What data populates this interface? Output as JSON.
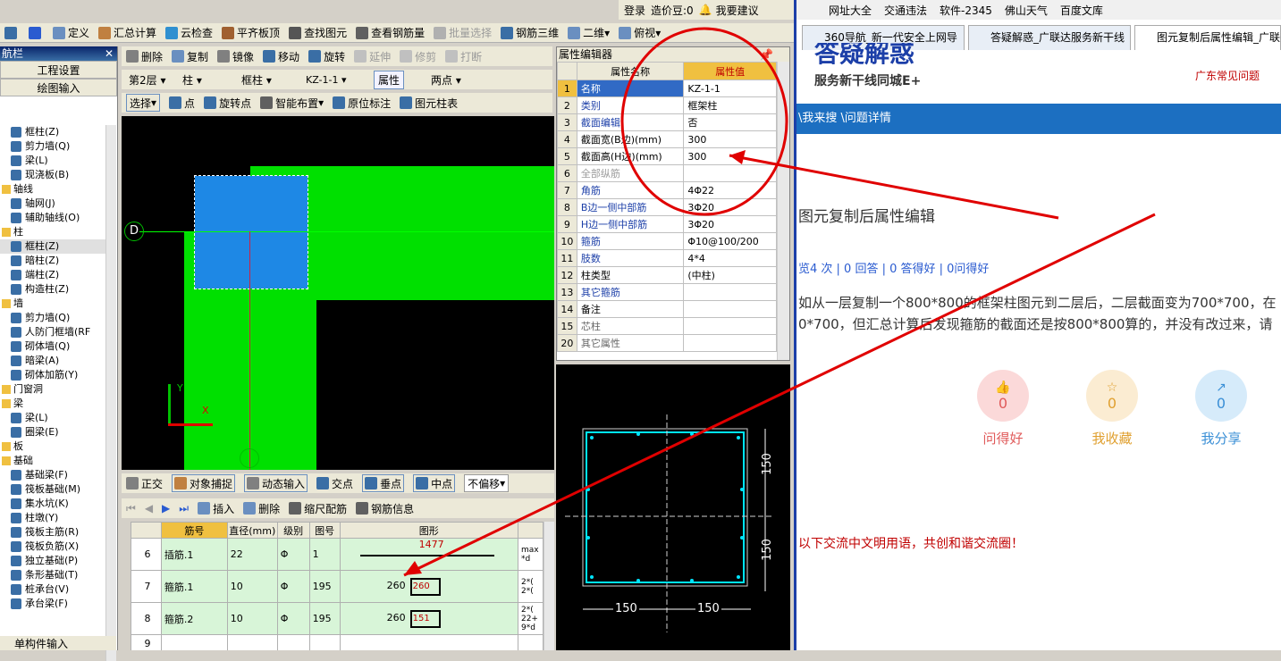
{
  "app": {
    "toolbar1": [
      "定义",
      "汇总计算",
      "云检查",
      "平齐板顶",
      "查找图元",
      "查看钢筋量",
      "批量选择",
      "钢筋三维",
      "二维",
      "俯视"
    ],
    "toolbar2": [
      "删除",
      "复制",
      "镜像",
      "移动",
      "旋转",
      "延伸",
      "修剪",
      "打断"
    ],
    "toolbar3": {
      "floor": "第2层",
      "type": "柱",
      "subtype": "框柱",
      "name": "KZ-1-1",
      "props": "属性",
      "twopoint": "两点"
    },
    "toolbar4": [
      "选择",
      "点",
      "旋转点",
      "智能布置",
      "原位标注",
      "图元柱表"
    ],
    "nav_title": "航栏",
    "nav_buttons": [
      "工程设置",
      "绘图输入"
    ],
    "nav_tree": [
      {
        "label": "框柱(Z)",
        "level": 2
      },
      {
        "label": "剪力墙(Q)",
        "level": 2
      },
      {
        "label": "梁(L)",
        "level": 2
      },
      {
        "label": "现浇板(B)",
        "level": 2
      },
      {
        "label": "轴线",
        "level": 1
      },
      {
        "label": "轴网(J)",
        "level": 2
      },
      {
        "label": "辅助轴线(O)",
        "level": 2
      },
      {
        "label": "柱",
        "level": 1
      },
      {
        "label": "框柱(Z)",
        "level": 2,
        "selected": true
      },
      {
        "label": "暗柱(Z)",
        "level": 2
      },
      {
        "label": "端柱(Z)",
        "level": 2
      },
      {
        "label": "构造柱(Z)",
        "level": 2
      },
      {
        "label": "墙",
        "level": 1
      },
      {
        "label": "剪力墙(Q)",
        "level": 2
      },
      {
        "label": "人防门框墙(RF",
        "level": 2
      },
      {
        "label": "砌体墙(Q)",
        "level": 2
      },
      {
        "label": "暗梁(A)",
        "level": 2
      },
      {
        "label": "砌体加筋(Y)",
        "level": 2
      },
      {
        "label": "门窗洞",
        "level": 1
      },
      {
        "label": "梁",
        "level": 1
      },
      {
        "label": "梁(L)",
        "level": 2
      },
      {
        "label": "圈梁(E)",
        "level": 2
      },
      {
        "label": "板",
        "level": 1
      },
      {
        "label": "基础",
        "level": 1
      },
      {
        "label": "基础梁(F)",
        "level": 2
      },
      {
        "label": "筏板基础(M)",
        "level": 2
      },
      {
        "label": "集水坑(K)",
        "level": 2
      },
      {
        "label": "柱墩(Y)",
        "level": 2
      },
      {
        "label": "筏板主筋(R)",
        "level": 2
      },
      {
        "label": "筏板负筋(X)",
        "level": 2
      },
      {
        "label": "独立基础(P)",
        "level": 2
      },
      {
        "label": "条形基础(T)",
        "level": 2
      },
      {
        "label": "桩承台(V)",
        "level": 2
      },
      {
        "label": "承台梁(F)",
        "level": 2
      }
    ],
    "nav_bottom": "单构件输入",
    "canvas": {
      "axis_label": "D",
      "y_label": "Y",
      "x_label": "X"
    },
    "snap_bar": [
      "正交",
      "对象捕捉",
      "动态输入",
      "交点",
      "垂点",
      "中点",
      "不偏移"
    ],
    "rebar_bar": [
      "插入",
      "删除",
      "缩尺配筋",
      "钢筋信息"
    ],
    "rebar_headers": [
      "筋号",
      "直径(mm)",
      "级别",
      "图号",
      "图形"
    ],
    "rebar_rows": [
      {
        "num": "6",
        "name": "插筋.1",
        "dia": "22",
        "grade": "Φ",
        "fig": "1",
        "shape_val": "1477",
        "val2": "",
        "extra": "max\n*d"
      },
      {
        "num": "7",
        "name": "箍筋.1",
        "dia": "10",
        "grade": "Φ",
        "fig": "195",
        "shape_val": "260",
        "val2": "260",
        "extra": "2*(\n2*("
      },
      {
        "num": "8",
        "name": "箍筋.2",
        "dia": "10",
        "grade": "Φ",
        "fig": "195",
        "shape_val": "260",
        "val2": "151",
        "extra": "2*(\n22+\n9*d"
      },
      {
        "num": "9",
        "name": "",
        "dia": "",
        "grade": "",
        "fig": "",
        "shape_val": "",
        "val2": "",
        "extra": ""
      }
    ],
    "prop_title": "属性编辑器",
    "prop_headers": [
      "属性名称",
      "属性值"
    ],
    "props": [
      {
        "n": "1",
        "name": "名称",
        "val": "KZ-1-1",
        "style": "sel"
      },
      {
        "n": "2",
        "name": "类别",
        "val": "框架柱",
        "style": "blue"
      },
      {
        "n": "3",
        "name": "截面编辑",
        "val": "否",
        "style": "blue"
      },
      {
        "n": "4",
        "name": "截面宽(B边)(mm)",
        "val": "300",
        "style": ""
      },
      {
        "n": "5",
        "name": "截面高(H边)(mm)",
        "val": "300",
        "style": ""
      },
      {
        "n": "6",
        "name": "全部纵筋",
        "val": "",
        "style": "grey"
      },
      {
        "n": "7",
        "name": "角筋",
        "val": "4Φ22",
        "style": "blue"
      },
      {
        "n": "8",
        "name": "B边一侧中部筋",
        "val": "3Φ20",
        "style": "blue"
      },
      {
        "n": "9",
        "name": "H边一侧中部筋",
        "val": "3Φ20",
        "style": "blue"
      },
      {
        "n": "10",
        "name": "箍筋",
        "val": "Φ10@100/200",
        "style": "blue"
      },
      {
        "n": "11",
        "name": "肢数",
        "val": "4*4",
        "style": "blue"
      },
      {
        "n": "12",
        "name": "柱类型",
        "val": "(中柱)",
        "style": ""
      },
      {
        "n": "13",
        "name": "其它箍筋",
        "val": "",
        "style": "blue"
      },
      {
        "n": "14",
        "name": "备注",
        "val": "",
        "style": ""
      },
      {
        "n": "15",
        "name": "芯柱",
        "val": "",
        "style": "exp"
      },
      {
        "n": "20",
        "name": "其它属性",
        "val": "",
        "style": "exp"
      }
    ],
    "section": {
      "dim1": "150",
      "dim2": "150",
      "dim3": "150",
      "dim4": "150"
    },
    "topbar": {
      "login": "登录",
      "beans": "造价豆:0",
      "want": "我要建议"
    }
  },
  "browser": {
    "bookmarks": [
      "网址大全",
      "交通违法",
      "软件-2345",
      "佛山天气",
      "百度文库"
    ],
    "tabs": [
      "360导航_新一代安全上网导",
      "答疑解惑_广联达服务新干线",
      "图元复制后属性编辑_广联达"
    ],
    "logo_text": "答疑解惑",
    "logo_sub": "服务新干线同城E+",
    "faq": "广东常见问题",
    "breadcrumb": "\\我来搜 \\问题详情",
    "question_title": "图元复制后属性编辑",
    "stats": "览4 次 | 0 回答 | 0 答得好 | 0问得好",
    "body_line1": "如从一层复制一个800*800的框架柱图元到二层后，二层截面变为700*700，在",
    "body_line2": "0*700，但汇总计算后发现箍筋的截面还是按800*800算的，并没有改过来，请",
    "actions": [
      {
        "label": "问得好",
        "count": "0",
        "color": "#e05a5a",
        "bg": "#fbd9d9"
      },
      {
        "label": "我收藏",
        "count": "0",
        "color": "#e0a030",
        "bg": "#fbecd2"
      },
      {
        "label": "我分享",
        "count": "0",
        "color": "#3a8fd6",
        "bg": "#d6ebfa"
      }
    ],
    "notice": "以下交流中文明用语，共创和谐交流圈！"
  }
}
